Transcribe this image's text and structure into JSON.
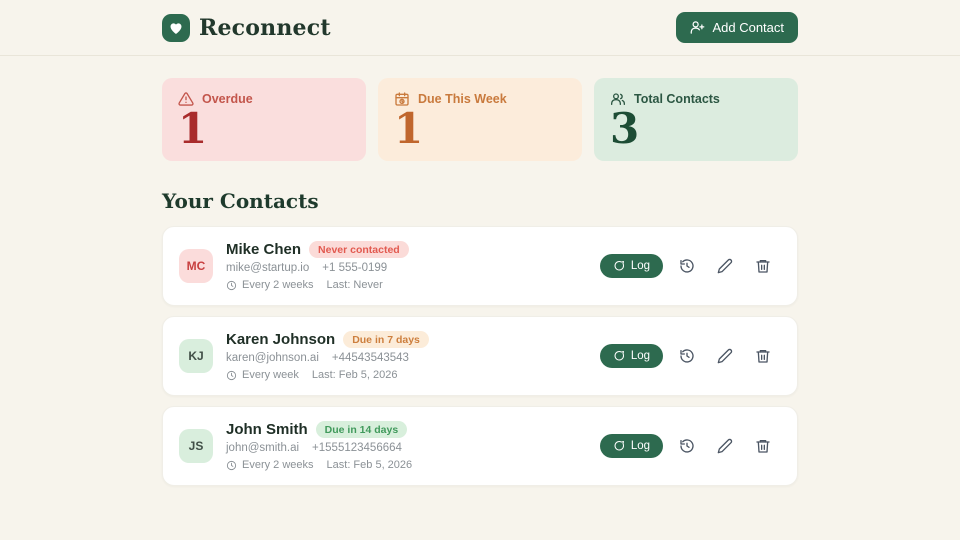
{
  "header": {
    "app_title": "Reconnect",
    "add_contact_label": "Add Contact"
  },
  "colors": {
    "primary_green": "#2d6a4f",
    "background": "#f7f4ec",
    "overdue_red": "#a92c2c",
    "due_orange": "#c0662d",
    "total_green": "#1d4d35",
    "badge_red_text": "#e25a50",
    "badge_orange_text": "#cd7f3e",
    "badge_green_text": "#419a5c"
  },
  "stats": [
    {
      "label": "Overdue",
      "value": "1",
      "icon": "warning-triangle-icon"
    },
    {
      "label": "Due This Week",
      "value": "1",
      "icon": "calendar-clock-icon"
    },
    {
      "label": "Total Contacts",
      "value": "3",
      "icon": "users-icon"
    }
  ],
  "contacts_section": {
    "heading": "Your Contacts",
    "log_button_label": "Log",
    "contacts": [
      {
        "initials": "MC",
        "name": "Mike Chen",
        "badge": "Never contacted",
        "status": "never-contacted",
        "email": "mike@startup.io",
        "phone": "+1 555-0199",
        "frequency": "Every 2 weeks",
        "last_contact": "Last: Never"
      },
      {
        "initials": "KJ",
        "name": "Karen Johnson",
        "badge": "Due in 7 days",
        "status": "due-soon",
        "email": "karen@johnson.ai",
        "phone": "+44543543543",
        "frequency": "Every week",
        "last_contact": "Last: Feb 5, 2026"
      },
      {
        "initials": "JS",
        "name": "John Smith",
        "badge": "Due in 14 days",
        "status": "upcoming",
        "email": "john@smith.ai",
        "phone": "+1555123456664",
        "frequency": "Every 2 weeks",
        "last_contact": "Last: Feb 5, 2026"
      }
    ]
  }
}
